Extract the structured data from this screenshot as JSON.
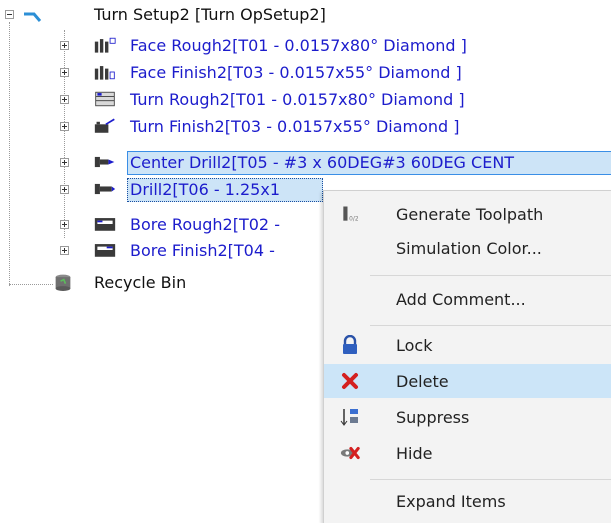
{
  "tree": {
    "root_label": "Turn Setup2 [Turn OpSetup2]",
    "operations": [
      {
        "label": "Face Rough2[T01 - 0.0157x80° Diamond ]",
        "icon": "face-rough-icon"
      },
      {
        "label": "Face Finish2[T03 - 0.0157x55° Diamond ]",
        "icon": "face-finish-icon"
      },
      {
        "label": "Turn Rough2[T01 - 0.0157x80° Diamond ]",
        "icon": "turn-rough-icon"
      },
      {
        "label": "Turn Finish2[T03 - 0.0157x55° Diamond ]",
        "icon": "turn-finish-icon"
      },
      {
        "label": "Center Drill2[T05 - #3 x 60DEG#3 60DEG CENT",
        "icon": "center-drill-icon"
      },
      {
        "label": "Drill2[T06 - 1.25x1",
        "icon": "drill-icon"
      },
      {
        "label": "Bore Rough2[T02 -",
        "icon": "bore-rough-icon"
      },
      {
        "label": "Bore Finish2[T04 -",
        "icon": "bore-finish-icon"
      }
    ],
    "recycle_bin_label": "Recycle Bin"
  },
  "context_menu": {
    "items": [
      {
        "label": "Generate Toolpath",
        "icon": "generate-toolpath-icon"
      },
      {
        "label": "Simulation Color...",
        "icon": ""
      },
      {
        "label": "Add Comment...",
        "icon": ""
      },
      {
        "label": "Lock",
        "icon": "lock-icon"
      },
      {
        "label": "Delete",
        "icon": "delete-icon",
        "highlighted": true
      },
      {
        "label": "Suppress",
        "icon": "suppress-icon"
      },
      {
        "label": "Hide",
        "icon": "hide-icon"
      },
      {
        "label": "Expand Items",
        "icon": ""
      }
    ]
  }
}
